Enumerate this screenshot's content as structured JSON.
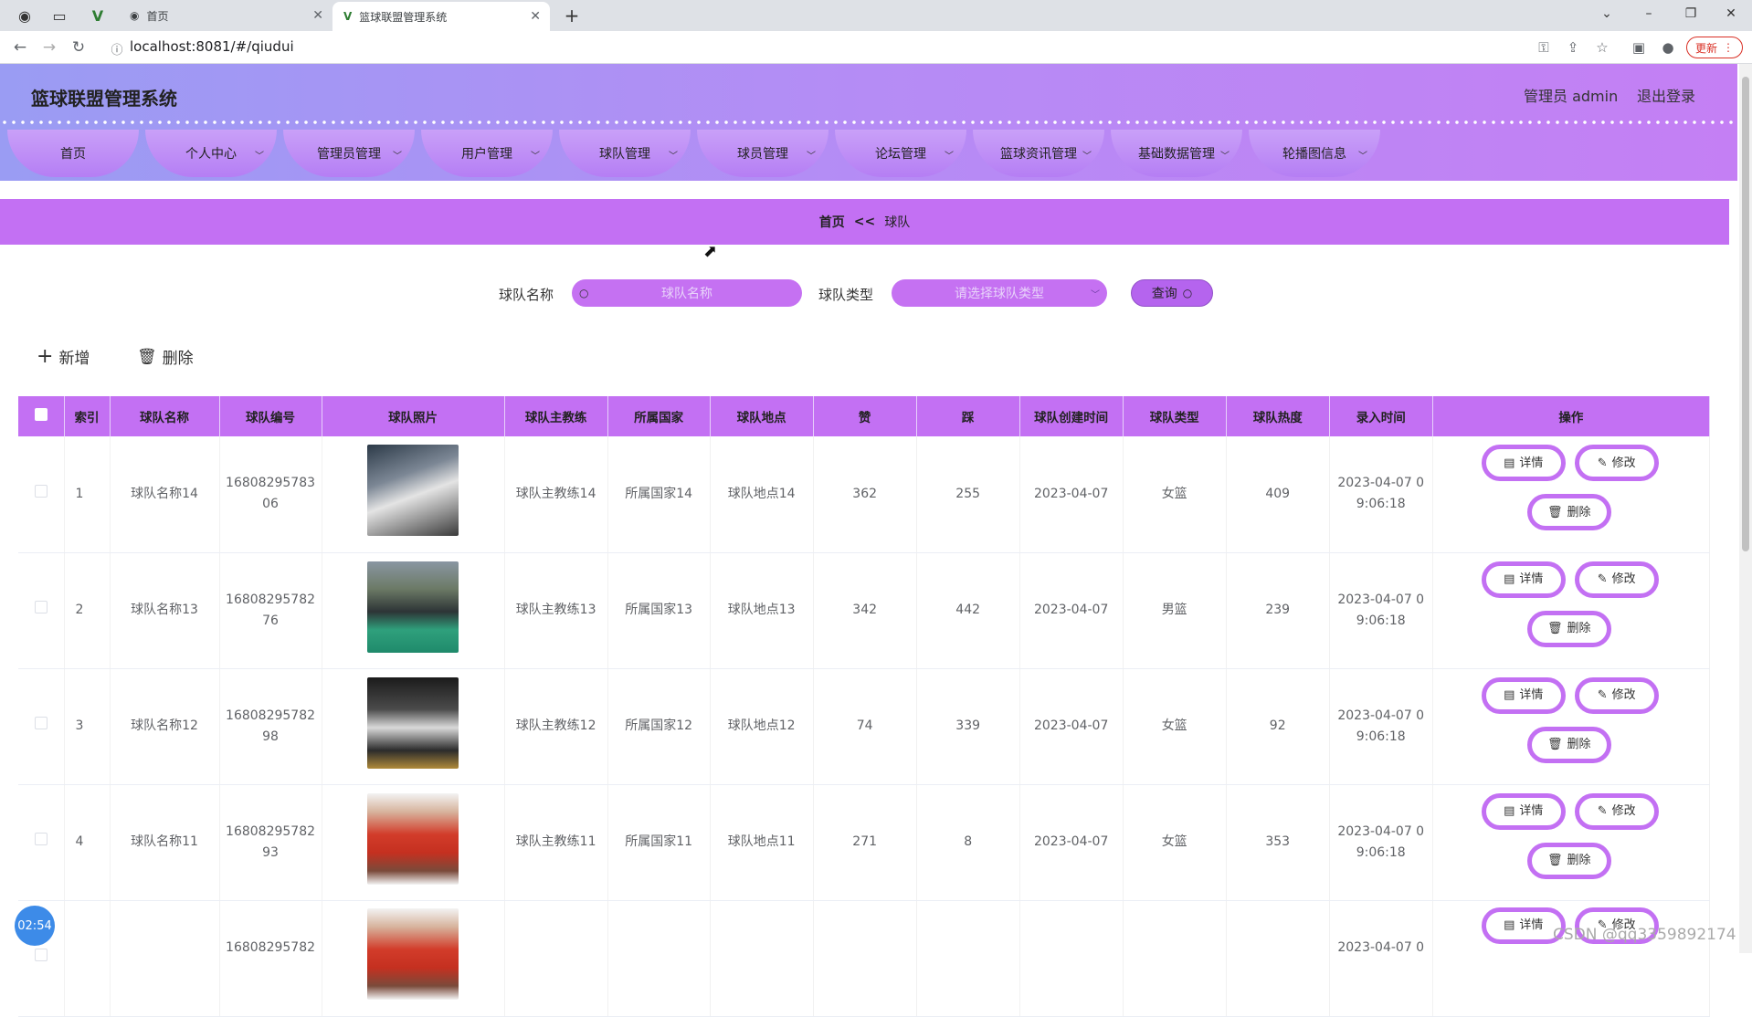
{
  "browser": {
    "tabs": [
      {
        "label": "首页",
        "active": false
      },
      {
        "label": "篮球联盟管理系统",
        "active": true
      }
    ],
    "url": "localhost:8081/#/qiudui",
    "update_label": "更新"
  },
  "header": {
    "title": "篮球联盟管理系统",
    "user_label": "管理员 admin",
    "logout_label": "退出登录"
  },
  "menu": [
    {
      "label": "首页",
      "has_dropdown": false
    },
    {
      "label": "个人中心",
      "has_dropdown": true
    },
    {
      "label": "管理员管理",
      "has_dropdown": true
    },
    {
      "label": "用户管理",
      "has_dropdown": true
    },
    {
      "label": "球队管理",
      "has_dropdown": true
    },
    {
      "label": "球员管理",
      "has_dropdown": true
    },
    {
      "label": "论坛管理",
      "has_dropdown": true
    },
    {
      "label": "篮球资讯管理",
      "has_dropdown": true
    },
    {
      "label": "基础数据管理",
      "has_dropdown": true
    },
    {
      "label": "轮播图信息",
      "has_dropdown": true
    }
  ],
  "breadcrumb": {
    "home": "首页",
    "separator": "<<",
    "current": "球队"
  },
  "search": {
    "name_label": "球队名称",
    "name_placeholder": "球队名称",
    "type_label": "球队类型",
    "type_placeholder": "请选择球队类型",
    "query_label": "查询"
  },
  "actions": {
    "add_label": "新增",
    "delete_label": "删除"
  },
  "table": {
    "columns": [
      "索引",
      "球队名称",
      "球队编号",
      "球队照片",
      "球队主教练",
      "所属国家",
      "球队地点",
      "赞",
      "踩",
      "球队创建时间",
      "球队类型",
      "球队热度",
      "录入时间",
      "操作"
    ],
    "rows": [
      {
        "index": "1",
        "name": "球队名称14",
        "code_a": "16808295783",
        "code_b": "06",
        "coach": "球队主教练14",
        "country": "所属国家14",
        "place": "球队地点14",
        "likes": "362",
        "dislikes": "255",
        "created": "2023-04-07",
        "type": "女篮",
        "heat": "409",
        "entered_a": "2023-04-07 0",
        "entered_b": "9:06:18"
      },
      {
        "index": "2",
        "name": "球队名称13",
        "code_a": "16808295782",
        "code_b": "76",
        "coach": "球队主教练13",
        "country": "所属国家13",
        "place": "球队地点13",
        "likes": "342",
        "dislikes": "442",
        "created": "2023-04-07",
        "type": "男篮",
        "heat": "239",
        "entered_a": "2023-04-07 0",
        "entered_b": "9:06:18"
      },
      {
        "index": "3",
        "name": "球队名称12",
        "code_a": "16808295782",
        "code_b": "98",
        "coach": "球队主教练12",
        "country": "所属国家12",
        "place": "球队地点12",
        "likes": "74",
        "dislikes": "339",
        "created": "2023-04-07",
        "type": "女篮",
        "heat": "92",
        "entered_a": "2023-04-07 0",
        "entered_b": "9:06:18"
      },
      {
        "index": "4",
        "name": "球队名称11",
        "code_a": "16808295782",
        "code_b": "93",
        "coach": "球队主教练11",
        "country": "所属国家11",
        "place": "球队地点11",
        "likes": "271",
        "dislikes": "8",
        "created": "2023-04-07",
        "type": "女篮",
        "heat": "353",
        "entered_a": "2023-04-07 0",
        "entered_b": "9:06:18"
      },
      {
        "index": "",
        "name": "",
        "code_a": "16808295782",
        "code_b": "",
        "coach": "",
        "country": "",
        "place": "",
        "likes": "",
        "dislikes": "",
        "created": "",
        "type": "",
        "heat": "",
        "entered_a": "2023-04-07 0",
        "entered_b": ""
      }
    ],
    "op_detail": "详情",
    "op_edit": "修改",
    "op_delete": "删除"
  },
  "timer": "02:54",
  "watermark": "CSDN @qq3359892174",
  "colors": {
    "accent": "#c370f3",
    "header_gradient_start": "#9a9cf3",
    "header_gradient_end": "#c47ff4"
  }
}
